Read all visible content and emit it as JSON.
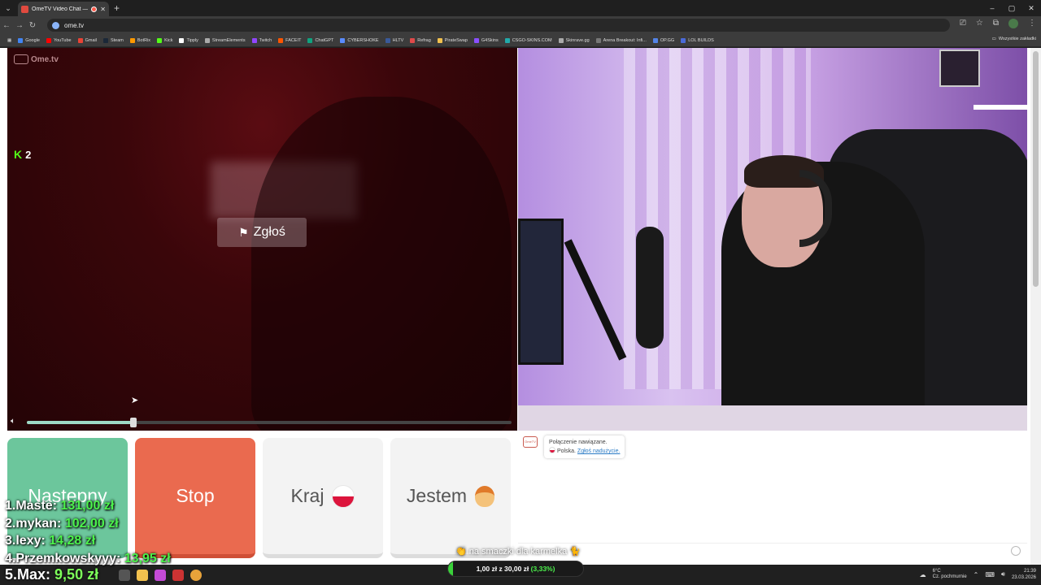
{
  "browser": {
    "tab_title": "OmeTV Video Chat — Ome",
    "url": "ome.tv",
    "new_tab": "+",
    "window_controls": [
      "–",
      "▢",
      "✕"
    ]
  },
  "bookmarks": {
    "items": [
      {
        "label": "Google",
        "color": "#4285f4"
      },
      {
        "label": "YouTube",
        "color": "#ff0000"
      },
      {
        "label": "Gmail",
        "color": "#ea4335"
      },
      {
        "label": "Steam",
        "color": "#1b2838"
      },
      {
        "label": "BotRix",
        "color": "#ff9900"
      },
      {
        "label": "Kick",
        "color": "#53fc18"
      },
      {
        "label": "Tipply",
        "color": "#ffffff"
      },
      {
        "label": "StreamElements",
        "color": "#aaaaaa"
      },
      {
        "label": "Twitch",
        "color": "#9146ff"
      },
      {
        "label": "FACEIT",
        "color": "#ff5500"
      },
      {
        "label": "ChatGPT",
        "color": "#10a37f"
      },
      {
        "label": "CYBERSHOKE",
        "color": "#5a8bff"
      },
      {
        "label": "HLTV",
        "color": "#3a5a9a"
      },
      {
        "label": "Refrag",
        "color": "#e04a4a"
      },
      {
        "label": "PirateSwap",
        "color": "#f2c14e"
      },
      {
        "label": "G4Skins",
        "color": "#8a4fff"
      },
      {
        "label": "CSGO-SKINS.COM",
        "color": "#2aa"
      },
      {
        "label": "Skinrave.gg",
        "color": "#aaa"
      },
      {
        "label": "Arena Breakout: Infi...",
        "color": "#777"
      },
      {
        "label": "OP.GG",
        "color": "#5383e8"
      },
      {
        "label": "LOL BUILDS",
        "color": "#4a6ad8"
      }
    ],
    "folder": "Wszystkie zakładki"
  },
  "video_left": {
    "logo": "Ome.tv",
    "kick_viewers": "2",
    "report_label": "Zgłoś",
    "volume_level": 0.22
  },
  "actions": {
    "next": "Następny",
    "stop": "Stop",
    "country": "Kraj",
    "gender": "Jestem"
  },
  "chat": {
    "logo": "OmeTV",
    "connected": "Połączenie nawiązane.",
    "country": "Polska.",
    "report_link": "Zgłoś nadużycie."
  },
  "leaderboard": [
    {
      "rank": "1.",
      "name": "Maste:",
      "amount": "131,00 zł"
    },
    {
      "rank": "2.",
      "name": "mykan:",
      "amount": "102,00 zł"
    },
    {
      "rank": "3.",
      "name": "lexy:",
      "amount": "14,28 zł"
    },
    {
      "rank": "4.",
      "name": "Przemkowskyyy:",
      "amount": "13,95 zł"
    }
  ],
  "top_donor": {
    "rank": "5.",
    "name": "Max:",
    "amount": "9,50 zł"
  },
  "overlay_message": "👏 na smaczki dla karmelka 🐈",
  "goal": {
    "text": "1,00 zł z 30,00 zł",
    "pct_label": "(3,33%)",
    "fraction": 0.0333
  },
  "taskbar": {
    "weather_temp": "6°C",
    "weather_desc": "Cz. pochmurnie",
    "time": "21:39",
    "date": "23.03.2026"
  }
}
